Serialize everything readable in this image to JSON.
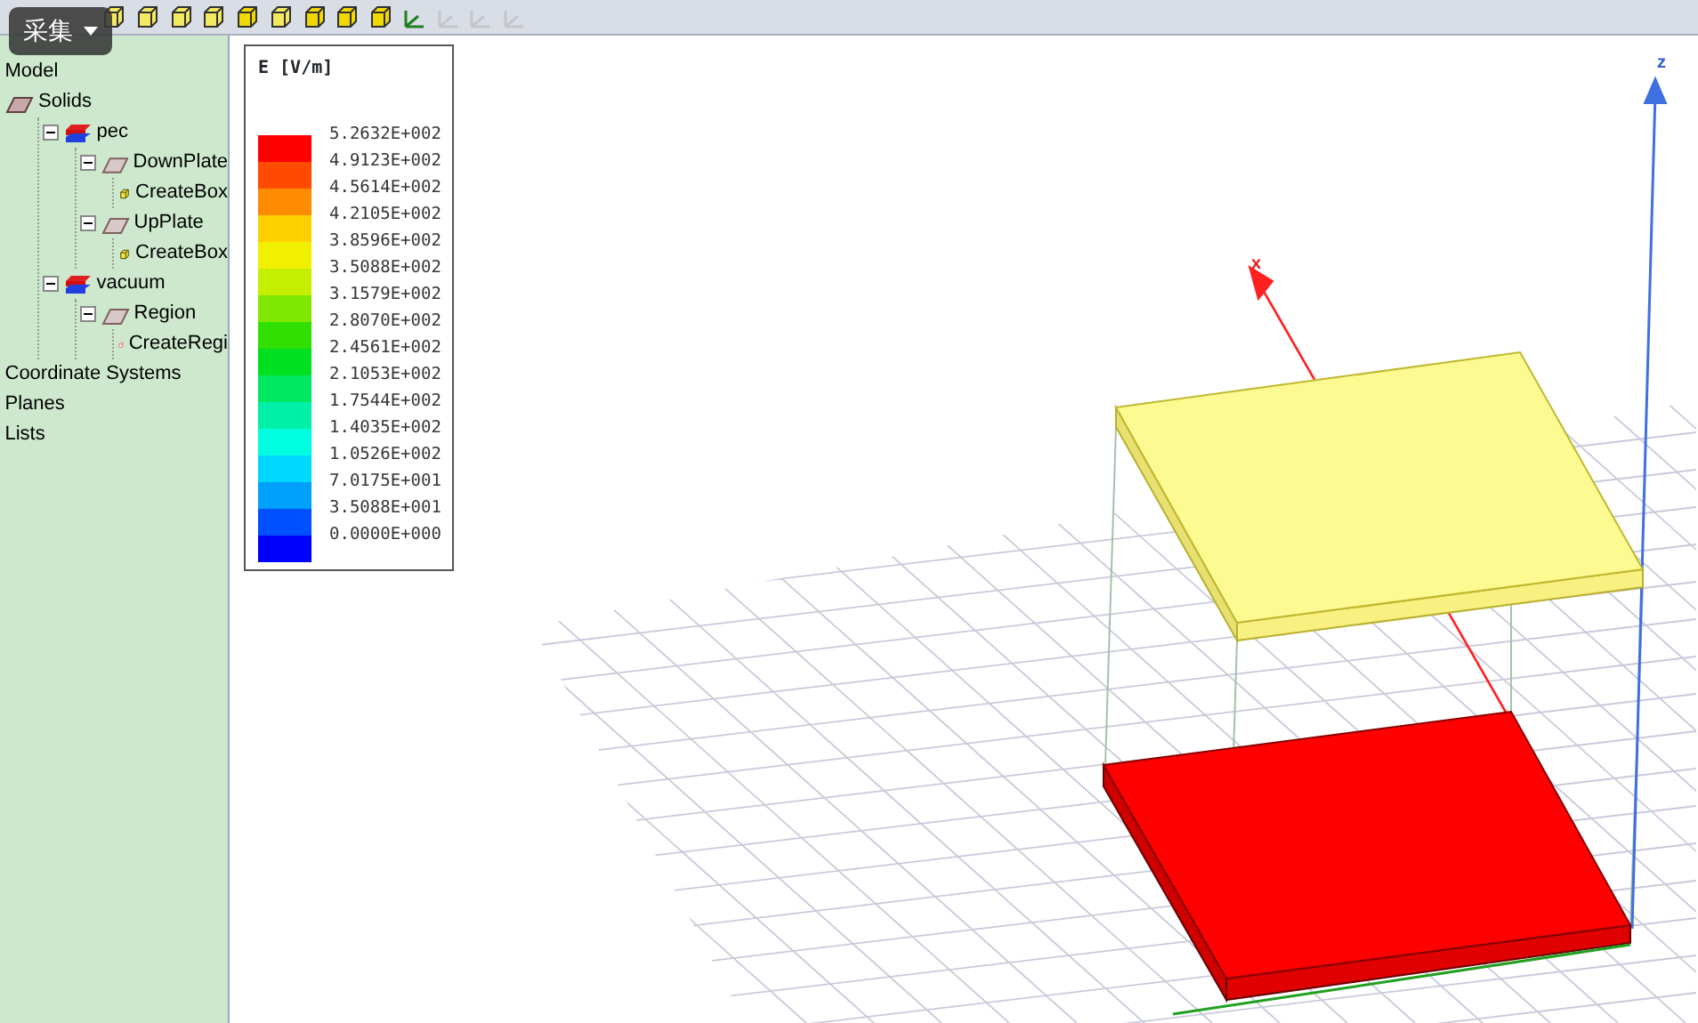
{
  "toolbar": {
    "icons": [
      {
        "kind": "cube-outline",
        "disabled": false
      },
      {
        "kind": "cube-outline",
        "disabled": false
      },
      {
        "kind": "cube-outline",
        "disabled": false
      },
      {
        "kind": "cube-outline",
        "disabled": false
      },
      {
        "kind": "cube-solid",
        "disabled": false
      },
      {
        "kind": "cube-outline",
        "disabled": false
      },
      {
        "kind": "cube-solid",
        "disabled": false
      },
      {
        "kind": "cube-solid",
        "disabled": false
      },
      {
        "kind": "cube-solid",
        "disabled": false
      },
      {
        "kind": "axes",
        "disabled": false
      },
      {
        "kind": "axes",
        "disabled": true
      },
      {
        "kind": "axes",
        "disabled": true
      },
      {
        "kind": "axes",
        "disabled": true
      }
    ]
  },
  "overlay_button": {
    "label": "采集"
  },
  "tree": [
    {
      "label": "Model",
      "kind": "none"
    },
    {
      "label": "Solids",
      "kind": "solid-group",
      "children": [
        {
          "label": "pec",
          "kind": "material",
          "expanded": true,
          "children": [
            {
              "label": "DownPlate",
              "kind": "object",
              "expanded": true,
              "children": [
                {
                  "label": "CreateBox",
                  "kind": "box"
                }
              ]
            },
            {
              "label": "UpPlate",
              "kind": "object",
              "expanded": true,
              "children": [
                {
                  "label": "CreateBox",
                  "kind": "box"
                }
              ]
            }
          ]
        },
        {
          "label": "vacuum",
          "kind": "material",
          "expanded": true,
          "children": [
            {
              "label": "Region",
              "kind": "object",
              "expanded": true,
              "children": [
                {
                  "label": "CreateRegi",
                  "kind": "region"
                }
              ]
            }
          ]
        }
      ]
    },
    {
      "label": "Coordinate Systems",
      "kind": "none"
    },
    {
      "label": "Planes",
      "kind": "none"
    },
    {
      "label": "Lists",
      "kind": "none"
    }
  ],
  "legend": {
    "title": "E [V/m]",
    "bands": [
      {
        "label": "5.2632E+002",
        "color": "#ff0000"
      },
      {
        "label": "4.9123E+002",
        "color": "#ff4a00"
      },
      {
        "label": "4.5614E+002",
        "color": "#ff8c00"
      },
      {
        "label": "4.2105E+002",
        "color": "#ffd000"
      },
      {
        "label": "3.8596E+002",
        "color": "#f0f000"
      },
      {
        "label": "3.5088E+002",
        "color": "#c4f000"
      },
      {
        "label": "3.1579E+002",
        "color": "#80e800"
      },
      {
        "label": "2.8070E+002",
        "color": "#30e000"
      },
      {
        "label": "2.4561E+002",
        "color": "#00e020"
      },
      {
        "label": "2.1053E+002",
        "color": "#00e860"
      },
      {
        "label": "1.7544E+002",
        "color": "#00f0a8"
      },
      {
        "label": "1.4035E+002",
        "color": "#00ffe0"
      },
      {
        "label": "1.0526E+002",
        "color": "#00d8ff"
      },
      {
        "label": "7.0175E+001",
        "color": "#00a0ff"
      },
      {
        "label": "3.5088E+001",
        "color": "#0050ff"
      },
      {
        "label": "0.0000E+000",
        "color": "#0000ff"
      }
    ]
  },
  "axes": [
    {
      "kind": "x",
      "label": "x"
    },
    {
      "kind": "z",
      "label": "z"
    }
  ]
}
